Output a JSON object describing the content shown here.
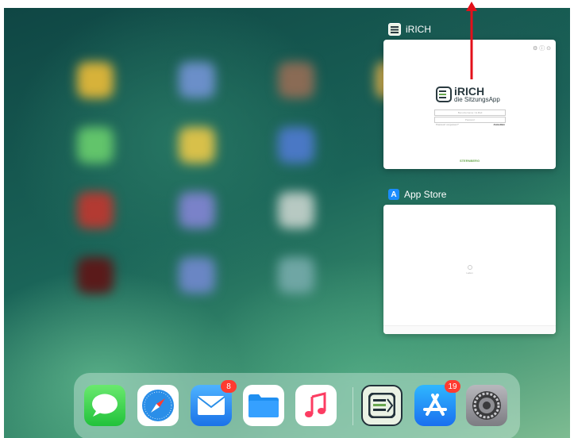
{
  "switcher": {
    "cards": [
      {
        "name": "iRICH",
        "preview": {
          "logo_title": "iRICH",
          "logo_subtitle": "die SitzungsApp",
          "input1_placeholder": "Benutzername / E-Mail",
          "input2_placeholder": "Passwort",
          "link_left": "Passwort vergessen?",
          "link_right": "Anmelden",
          "footer": "STERNBERG"
        }
      },
      {
        "name": "App Store",
        "preview": {
          "status": "Laden"
        }
      }
    ]
  },
  "dock": {
    "apps": [
      {
        "name": "Messages",
        "icon": "messages-icon"
      },
      {
        "name": "Safari",
        "icon": "safari-icon"
      },
      {
        "name": "Mail",
        "icon": "mail-icon",
        "badge": "8"
      },
      {
        "name": "Files",
        "icon": "files-icon"
      },
      {
        "name": "Music",
        "icon": "music-icon"
      },
      {
        "name": "iRICH",
        "icon": "irich-icon"
      },
      {
        "name": "App Store",
        "icon": "app-store-icon",
        "badge": "19"
      },
      {
        "name": "Settings",
        "icon": "settings-icon"
      }
    ]
  },
  "colors": {
    "arrow": "#e3101a",
    "badge": "#ff3b30",
    "irich_green": "#6aa84f",
    "app_store_blue": "#1a8cff"
  }
}
